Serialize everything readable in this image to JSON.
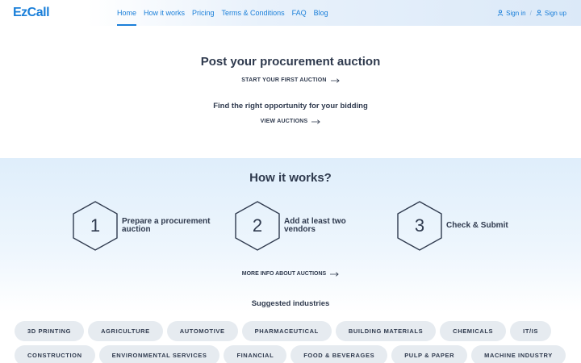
{
  "header": {
    "logo": "EzCall",
    "nav": [
      "Home",
      "How it works",
      "Pricing",
      "Terms & Conditions",
      "FAQ",
      "Blog"
    ],
    "active_index": 0,
    "sign_in": "Sign in",
    "separator": "/",
    "sign_up": "Sign up"
  },
  "hero": {
    "title": "Post your procurement auction",
    "cta_start": "START YOUR FIRST AUCTION",
    "subtitle": "Find the right opportunity for your bidding",
    "cta_view": "VIEW AUCTIONS"
  },
  "how": {
    "title": "How it works?",
    "steps": [
      {
        "number": "1",
        "label": "Prepare a procurement auction"
      },
      {
        "number": "2",
        "label": "Add at least two vendors"
      },
      {
        "number": "3",
        "label": "Check & Submit"
      }
    ],
    "more_info": "MORE INFO ABOUT AUCTIONS",
    "suggested_title": "Suggested industries",
    "industries": [
      "3D PRINTING",
      "AGRICULTURE",
      "AUTOMOTIVE",
      "PHARMACEUTICAL",
      "BUILDING MATERIALS",
      "CHEMICALS",
      "IT/IS",
      "CONSTRUCTION",
      "ENVIRONMENTAL SERVICES",
      "FINANCIAL",
      "FOOD & BEVERAGES",
      "PULP & PAPER",
      "MACHINE INDUSTRY"
    ]
  },
  "colors": {
    "accent": "#1a7fd9",
    "text": "#2f3a4e",
    "chip": "#e6ebf0"
  },
  "icons": {
    "user": "user-icon",
    "arrow": "arrow-right-icon"
  }
}
